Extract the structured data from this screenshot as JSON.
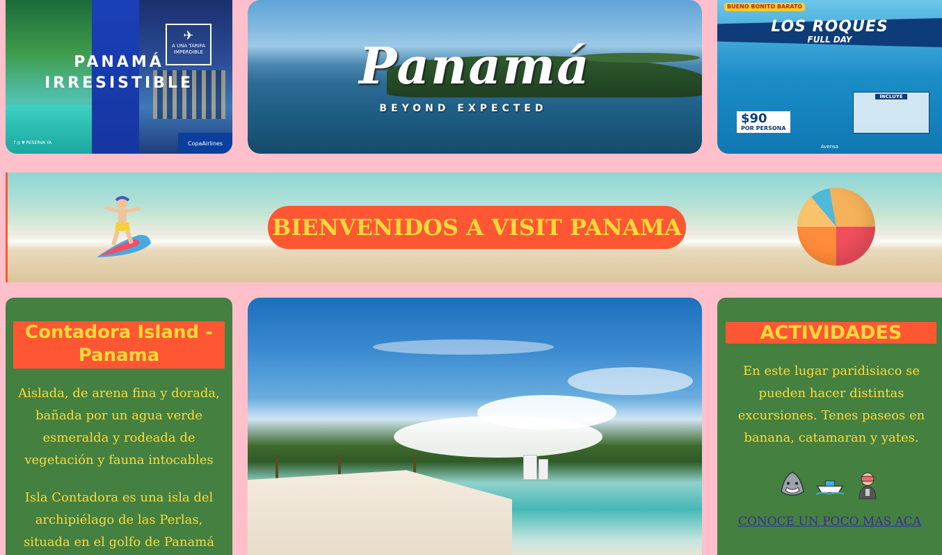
{
  "banners": {
    "left": {
      "title_line1": "PANAMÁ",
      "title_line2": "IRRESISTIBLE",
      "stamp_text": "A UNA TARIFA IMPERDIBLE",
      "social_text": "f ◎ ▼ RESERVA YA",
      "brand": "CopaAirlines"
    },
    "middle": {
      "script_title": "Panamá",
      "tagline": "BEYOND EXPECTED"
    },
    "right": {
      "badge": "BUENO BONITO BARATO",
      "title": "LOS ROQUES",
      "subtitle": "FULL DAY",
      "price": "$90",
      "price_note": "POR PERSONA",
      "includes_label": "INCLUYE",
      "footer": "Avensa"
    }
  },
  "welcome": {
    "title": "BIENVENIDOS A VISIT PANAMA"
  },
  "contadora": {
    "title": "Contadora Island - Panama",
    "paragraph1": "Aislada, de arena fina y dorada, bañada por un agua verde esmeralda y rodeada de vegetación y fauna intocables",
    "paragraph2": "Isla Contadora es una isla del archipiélago de las Perlas, situada en el golfo de Panamá (Panamá), a"
  },
  "actividades": {
    "title": "ACTIVIDADES",
    "text": "En este lugar paridisiaco se pueden hacer distintas excursiones. Tenes paseos en banana, catamaran y yates.",
    "icons": [
      "shark-icon",
      "boat-icon",
      "diver-icon"
    ],
    "link_text": "CONOCE UN POCO MAS ACA"
  },
  "colors": {
    "page_bg": "#ffc0cb",
    "card_green": "#448040",
    "accent_orange": "#ff5733",
    "accent_yellow": "#ffd93b",
    "link_color": "#3a2a9a"
  }
}
